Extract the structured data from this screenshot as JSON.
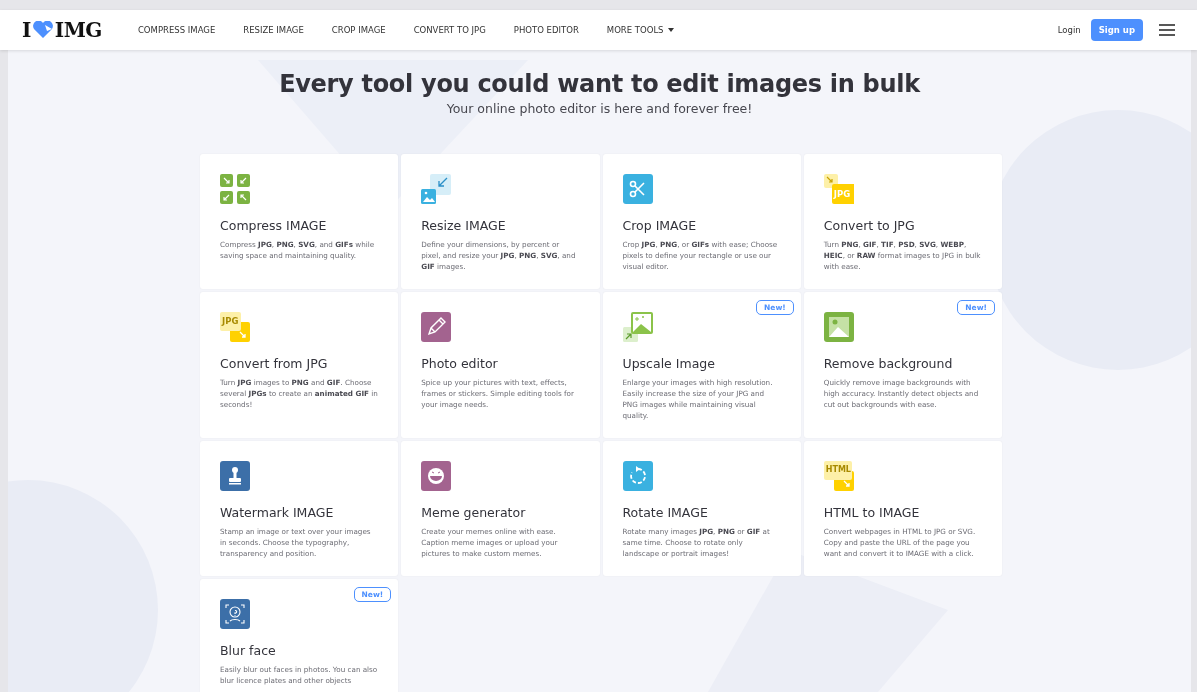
{
  "header": {
    "logo": {
      "left": "I",
      "right": "IMG"
    },
    "nav": [
      {
        "label": "COMPRESS IMAGE"
      },
      {
        "label": "RESIZE IMAGE"
      },
      {
        "label": "CROP IMAGE"
      },
      {
        "label": "CONVERT TO JPG"
      },
      {
        "label": "PHOTO EDITOR"
      },
      {
        "label": "MORE TOOLS",
        "dropdown": true
      }
    ],
    "login": "Login",
    "signup": "Sign up"
  },
  "hero": {
    "title": "Every tool you could want to edit images in bulk",
    "subtitle": "Your online photo editor is here and forever free!"
  },
  "tools": [
    {
      "kind": "compress",
      "title": "Compress IMAGE",
      "description": "Compress **JPG**, **PNG**, **SVG**, and **GIFs** while saving space and maintaining quality."
    },
    {
      "kind": "resize",
      "title": "Resize IMAGE",
      "description": "Define your dimensions, by percent or pixel, and resize your **JPG**, **PNG**, **SVG**, and **GIF** images."
    },
    {
      "kind": "crop",
      "title": "Crop IMAGE",
      "description": "Crop **JPG**, **PNG**, or **GIFs** with ease; Choose pixels to define your rectangle or use our visual editor."
    },
    {
      "kind": "to-jpg",
      "icon_text": "JPG",
      "title": "Convert to JPG",
      "description": "Turn **PNG**, **GIF**, **TIF**, **PSD**, **SVG**, **WEBP**, **HEIC**, or **RAW** format images to JPG in bulk with ease."
    },
    {
      "kind": "from-jpg",
      "icon_text": "JPG",
      "title": "Convert from JPG",
      "description": "Turn **JPG** images to **PNG** and **GIF**. Choose several **JPGs** to create an **animated GIF** in seconds!"
    },
    {
      "kind": "editor",
      "title": "Photo editor",
      "description": "Spice up your pictures with text, effects, frames or stickers. Simple editing tools for your image needs."
    },
    {
      "kind": "upscale",
      "badge": "New!",
      "title": "Upscale Image",
      "description": "Enlarge your images with high resolution. Easily increase the size of your JPG and PNG images while maintaining visual quality."
    },
    {
      "kind": "remove-bg",
      "badge": "New!",
      "title": "Remove background",
      "description": "Quickly remove image backgrounds with high accuracy. Instantly detect objects and cut out backgrounds with ease."
    },
    {
      "kind": "watermark",
      "title": "Watermark IMAGE",
      "description": "Stamp an image or text over your images in seconds. Choose the typography, transparency and position."
    },
    {
      "kind": "meme",
      "title": "Meme generator",
      "description": "Create your memes online with ease. Caption meme images or upload your pictures to make custom memes."
    },
    {
      "kind": "rotate",
      "title": "Rotate IMAGE",
      "description": "Rotate many images **JPG**, **PNG** or **GIF** at same time. Choose to rotate only landscape or portrait images!"
    },
    {
      "kind": "html",
      "icon_text": "HTML",
      "title": "HTML to IMAGE",
      "description": "Convert webpages in HTML to JPG or SVG. Copy and paste the URL of the page you want and convert it to IMAGE with a click."
    },
    {
      "kind": "blur",
      "badge": "New!",
      "title": "Blur face",
      "description": "Easily blur out faces in photos. You can also blur licence plates and other objects"
    }
  ]
}
